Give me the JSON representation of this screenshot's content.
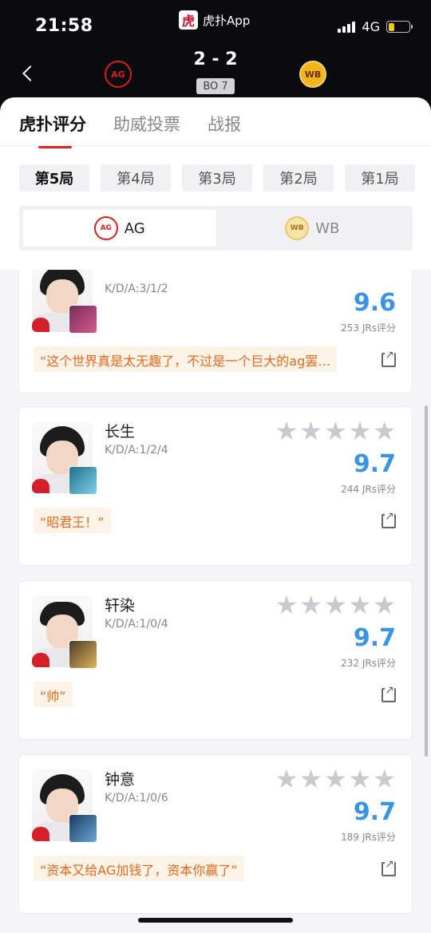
{
  "status_bar": {
    "time": "21:58",
    "app_name": "虎扑App",
    "app_logo_char": "虎",
    "network": "4G"
  },
  "match": {
    "score": "2 - 2",
    "format": "BO 7",
    "team_left_logo_text": "AG",
    "team_right_logo_text": "WB"
  },
  "main_tabs": [
    "虎扑评分",
    "助威投票",
    "战报"
  ],
  "game_tabs": [
    "第5局",
    "第4局",
    "第3局",
    "第2局",
    "第1局"
  ],
  "teams": {
    "left": "AG",
    "right": "WB"
  },
  "players": [
    {
      "name": "",
      "kda": "K/D/A:3/1/2",
      "rating": "9.6",
      "votes": "253 JRs评分",
      "comment": "“这个世界真是太无趣了，不过是一个巨大的ag罢…"
    },
    {
      "name": "长生",
      "kda": "K/D/A:1/2/4",
      "rating": "9.7",
      "votes": "244 JRs评分",
      "comment": "“昭君王！”"
    },
    {
      "name": "轩染",
      "kda": "K/D/A:1/0/4",
      "rating": "9.7",
      "votes": "232 JRs评分",
      "comment": "“帅”"
    },
    {
      "name": "钟意",
      "kda": "K/D/A:1/0/6",
      "rating": "9.7",
      "votes": "189 JRs评分",
      "comment": "“资本又给AG加钱了，资本你赢了”"
    }
  ],
  "colors": {
    "accent": "#e2231a",
    "rating": "#3a94e6",
    "comment": "#e56a1f"
  }
}
